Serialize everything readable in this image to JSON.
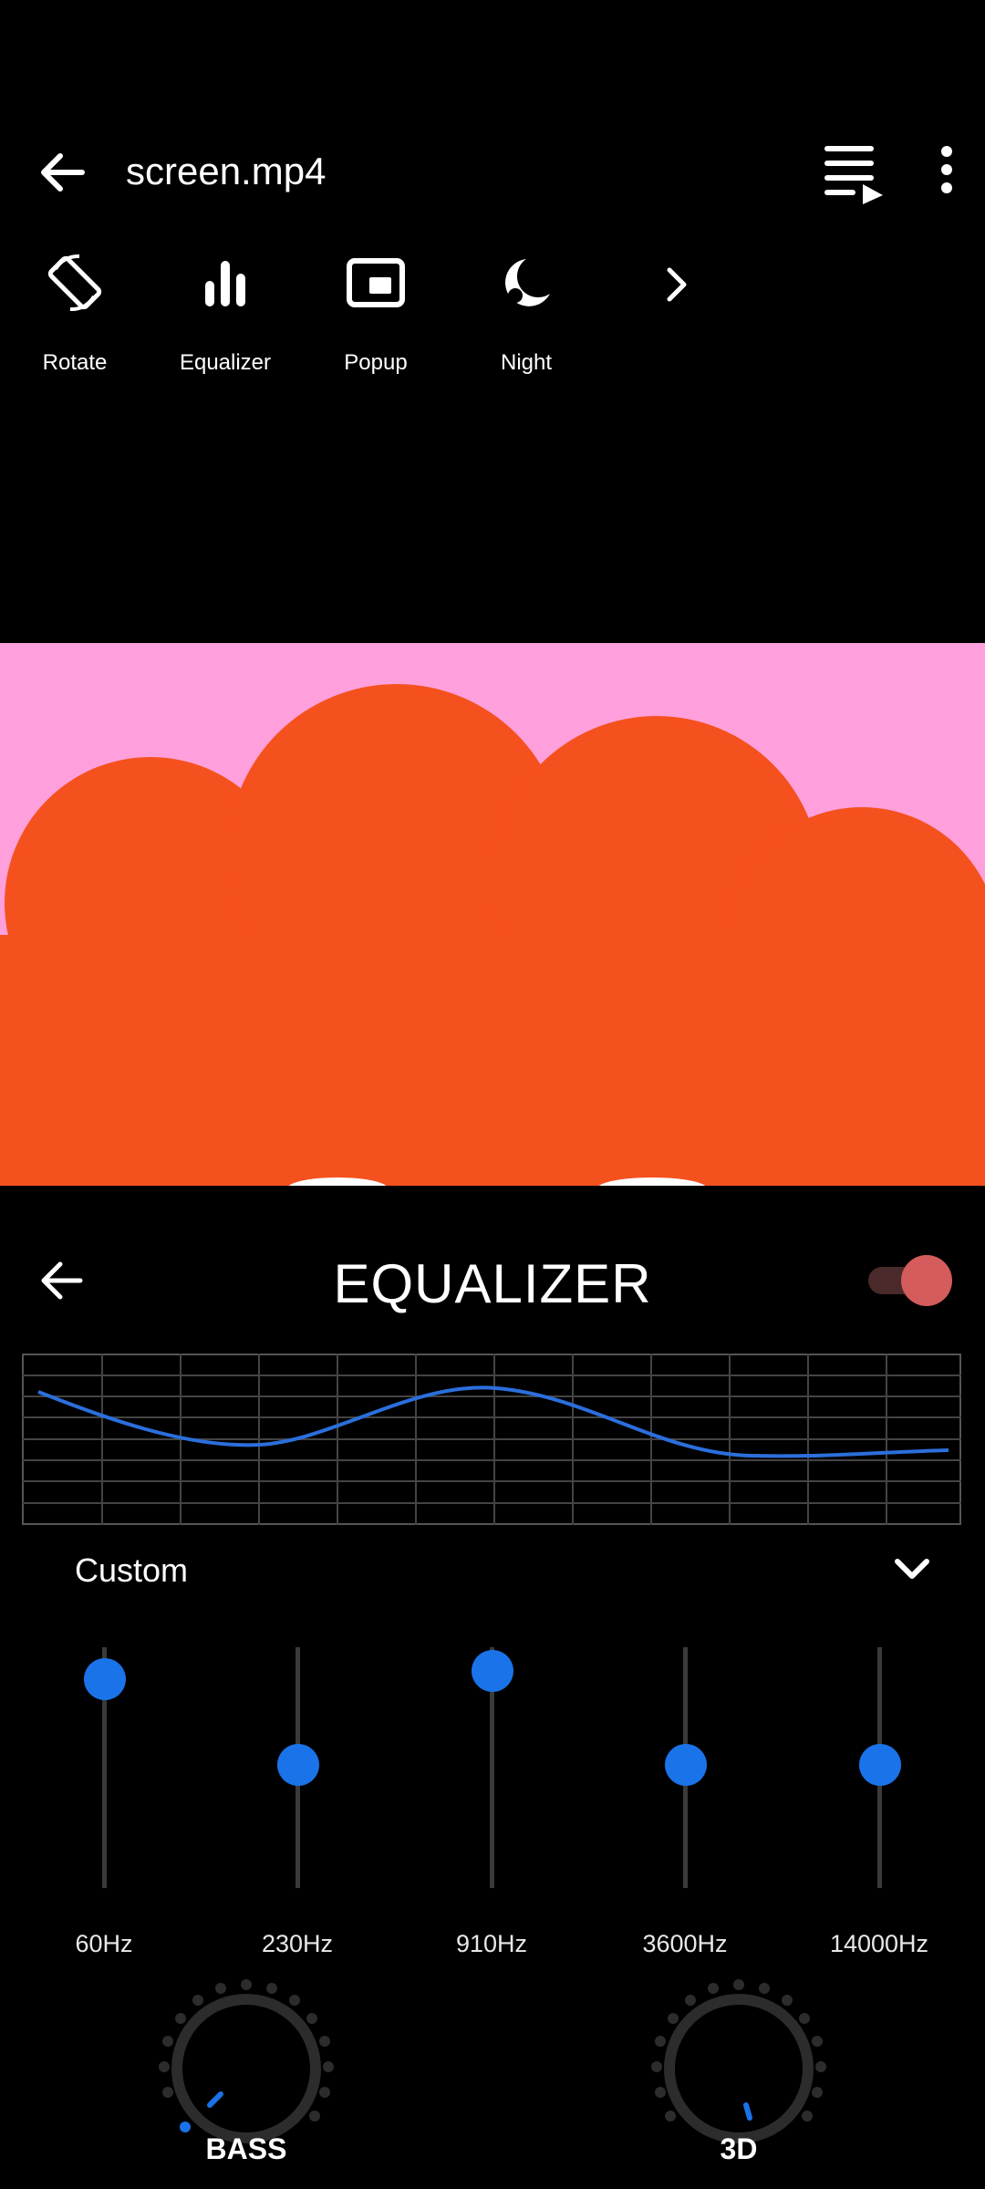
{
  "header": {
    "title": "screen.mp4"
  },
  "tools": [
    {
      "label": "Rotate",
      "icon": "rotate-icon"
    },
    {
      "label": "Equalizer",
      "icon": "equalizer-icon"
    },
    {
      "label": "Popup",
      "icon": "popup-icon"
    },
    {
      "label": "Night",
      "icon": "night-icon"
    }
  ],
  "equalizer": {
    "title": "EQUALIZER",
    "enabled": true,
    "preset": "Custom",
    "bands": [
      {
        "label": "60Hz",
        "level": 0.92
      },
      {
        "label": "230Hz",
        "level": 0.5
      },
      {
        "label": "910Hz",
        "level": 0.96
      },
      {
        "label": "3600Hz",
        "level": 0.5
      },
      {
        "label": "14000Hz",
        "level": 0.5
      }
    ],
    "knobs": [
      {
        "label": "BASS"
      },
      {
        "label": "3D"
      }
    ]
  },
  "colors": {
    "accent": "#1a73e8",
    "video_background": "#ffa0dc",
    "video_shape": "#f5511e",
    "toggle_thumb": "#d45c5c"
  }
}
